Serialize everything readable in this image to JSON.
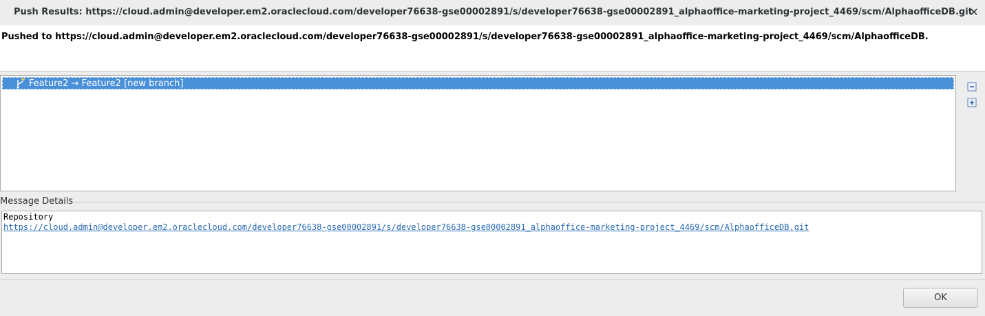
{
  "window": {
    "title": "Push Results: https://cloud.admin@developer.em2.oraclecloud.com/developer76638-gse00002891/s/developer76638-gse00002891_alphaoffice-marketing-project_4469/scm/AlphaofficeDB.git",
    "close_glyph": "✕"
  },
  "header": {
    "message": "Pushed to https://cloud.admin@developer.em2.oraclecloud.com/developer76638-gse00002891/s/developer76638-gse00002891_alphaoffice-marketing-project_4469/scm/AlphaofficeDB."
  },
  "results": {
    "rows": [
      {
        "icon": "branch-new-icon",
        "label": "Feature2 → Feature2 [new branch]",
        "selected": true
      }
    ],
    "side_buttons": [
      {
        "icon": "collapse-all-icon"
      },
      {
        "icon": "expand-all-icon"
      }
    ]
  },
  "message_details": {
    "legend": "Message Details",
    "line1": "Repository",
    "link": "https://cloud.admin@developer.em2.oraclecloud.com/developer76638-gse00002891/s/developer76638-gse00002891_alphaoffice-marketing-project_4469/scm/AlphaofficeDB.git"
  },
  "footer": {
    "ok_label": "OK"
  },
  "colors": {
    "selection": "#4a90d9",
    "link": "#2a6bb5",
    "background": "#ededed"
  }
}
